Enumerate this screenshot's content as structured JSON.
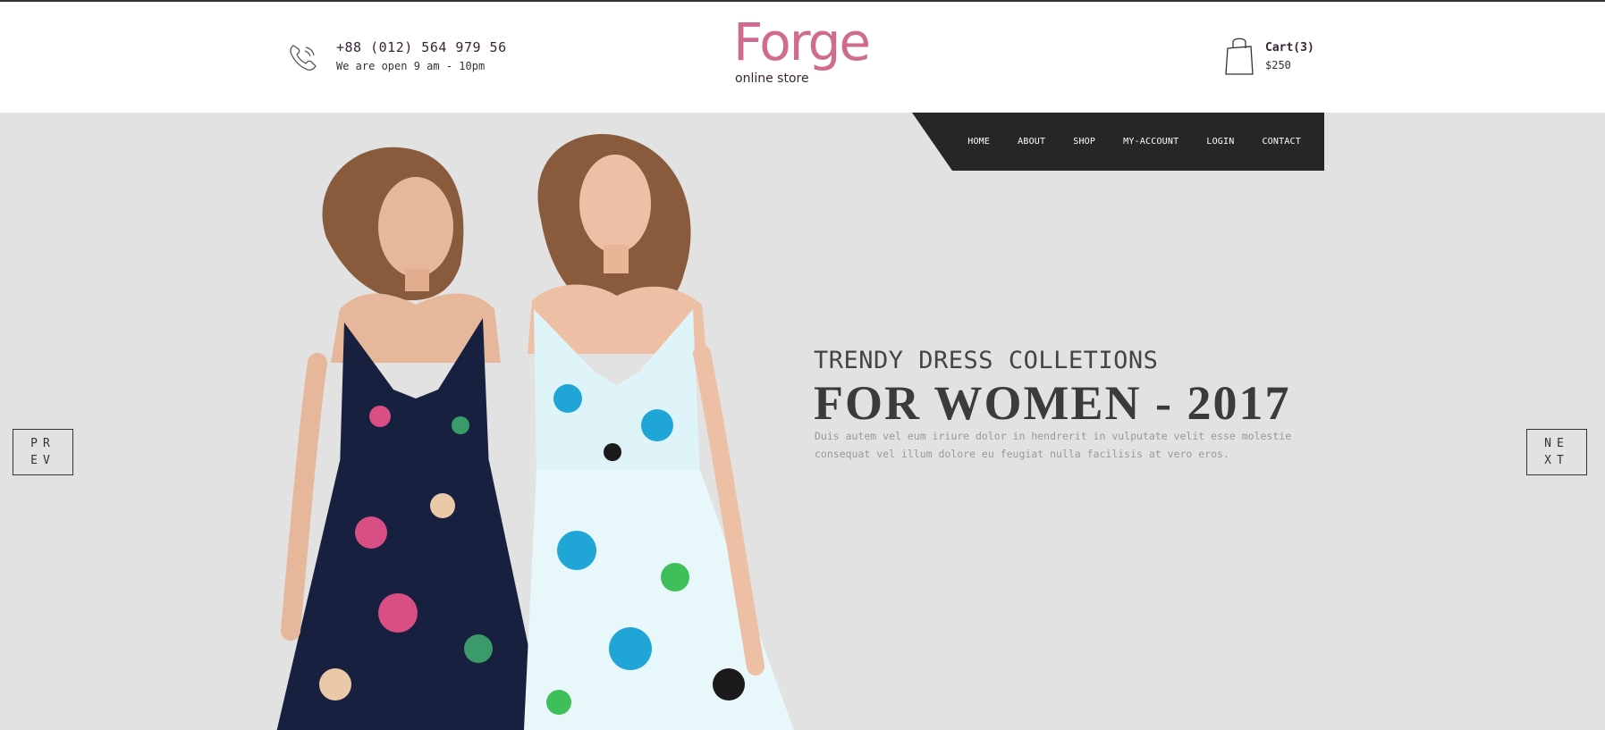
{
  "header": {
    "phone": "+88 (012) 564 979 56",
    "hours": "We are open 9 am - 10pm",
    "logo_main": "Forge",
    "logo_sub": "online store",
    "cart_label": "Cart(3)",
    "cart_total": "$250"
  },
  "nav": {
    "items": [
      "HOME",
      "ABOUT",
      "SHOP",
      "MY-ACCOUNT",
      "LOGIN",
      "CONTACT"
    ]
  },
  "hero": {
    "subtitle": "TRENDY DRESS COLLETIONS",
    "headline": "FOR WOMEN - 2017",
    "description": "Duis autem vel eum iriure dolor in hendrerit in vulputate velit esse molestie consequat vel illum dolore eu feugiat nulla facilisis at vero eros.",
    "prev_line1": "PR",
    "prev_line2": "EV",
    "next_line1": "NE",
    "next_line2": "XT"
  },
  "colors": {
    "brand": "#d06a8e",
    "nav_bg": "#262626",
    "hero_bg": "#e2e2e2",
    "text_dark": "#3a2433"
  }
}
